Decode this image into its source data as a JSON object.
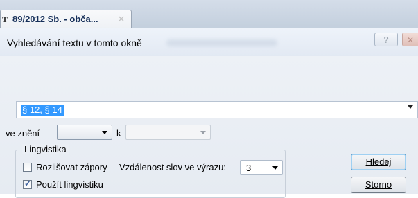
{
  "tab": {
    "title": "89/2012 Sb. - obča...",
    "close_glyph": "✕",
    "icon": "document-icon"
  },
  "dialog": {
    "title": "Vyhledávání textu v tomto okně",
    "help_glyph": "?",
    "close_glyph": "✕"
  },
  "search": {
    "value": "§ 12, § 14"
  },
  "version": {
    "label": "ve znění",
    "from_value": "",
    "to_label": "k",
    "to_value": ""
  },
  "linguistics": {
    "legend": "Lingvistika",
    "distinguish_negation": {
      "label": "Rozlišovat zápory",
      "checked": false
    },
    "use_linguistics": {
      "label": "Použít lingvistiku",
      "checked": true
    },
    "distance_label": "Vzdálenost slov ve výrazu:",
    "distance_value": "3"
  },
  "buttons": {
    "search": "Hledej",
    "cancel": "Storno"
  }
}
